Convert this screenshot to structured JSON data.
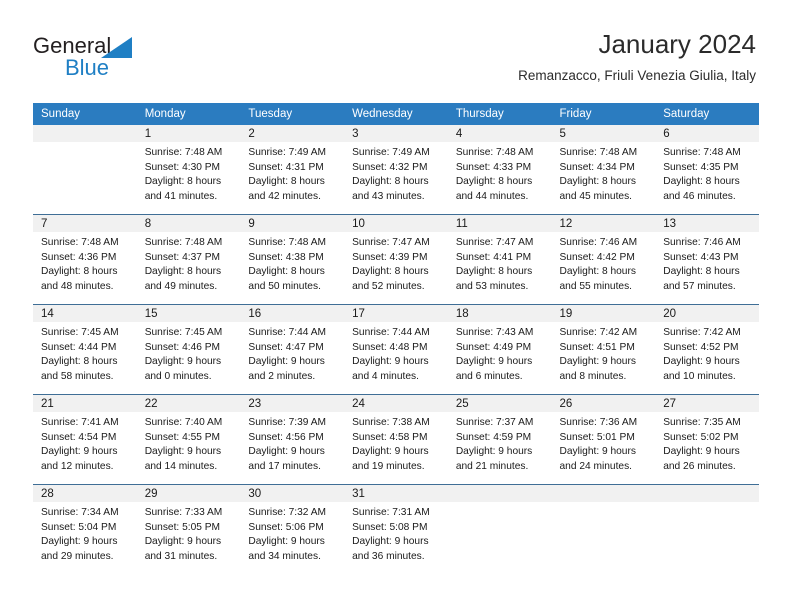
{
  "brand": {
    "word_one": "General",
    "word_two": "Blue",
    "triangle_color": "#1f7fc4",
    "word_one_color": "#231f20",
    "word_two_color": "#1f7fc4"
  },
  "header": {
    "title": "January 2024",
    "subtitle": "Remanzacco, Friuli Venezia Giulia, Italy"
  },
  "theme": {
    "header_bg": "#2b7cc0",
    "header_text": "#ffffff",
    "daynum_bg": "#f1f1f1",
    "row_rule": "#3f6e96",
    "body_text": "#1a1a1a"
  },
  "calendar": {
    "weekday_headers": [
      "Sunday",
      "Monday",
      "Tuesday",
      "Wednesday",
      "Thursday",
      "Friday",
      "Saturday"
    ],
    "weeks": [
      [
        {
          "day": "",
          "lines": []
        },
        {
          "day": "1",
          "lines": [
            "Sunrise: 7:48 AM",
            "Sunset: 4:30 PM",
            "Daylight: 8 hours",
            "and 41 minutes."
          ]
        },
        {
          "day": "2",
          "lines": [
            "Sunrise: 7:49 AM",
            "Sunset: 4:31 PM",
            "Daylight: 8 hours",
            "and 42 minutes."
          ]
        },
        {
          "day": "3",
          "lines": [
            "Sunrise: 7:49 AM",
            "Sunset: 4:32 PM",
            "Daylight: 8 hours",
            "and 43 minutes."
          ]
        },
        {
          "day": "4",
          "lines": [
            "Sunrise: 7:48 AM",
            "Sunset: 4:33 PM",
            "Daylight: 8 hours",
            "and 44 minutes."
          ]
        },
        {
          "day": "5",
          "lines": [
            "Sunrise: 7:48 AM",
            "Sunset: 4:34 PM",
            "Daylight: 8 hours",
            "and 45 minutes."
          ]
        },
        {
          "day": "6",
          "lines": [
            "Sunrise: 7:48 AM",
            "Sunset: 4:35 PM",
            "Daylight: 8 hours",
            "and 46 minutes."
          ]
        }
      ],
      [
        {
          "day": "7",
          "lines": [
            "Sunrise: 7:48 AM",
            "Sunset: 4:36 PM",
            "Daylight: 8 hours",
            "and 48 minutes."
          ]
        },
        {
          "day": "8",
          "lines": [
            "Sunrise: 7:48 AM",
            "Sunset: 4:37 PM",
            "Daylight: 8 hours",
            "and 49 minutes."
          ]
        },
        {
          "day": "9",
          "lines": [
            "Sunrise: 7:48 AM",
            "Sunset: 4:38 PM",
            "Daylight: 8 hours",
            "and 50 minutes."
          ]
        },
        {
          "day": "10",
          "lines": [
            "Sunrise: 7:47 AM",
            "Sunset: 4:39 PM",
            "Daylight: 8 hours",
            "and 52 minutes."
          ]
        },
        {
          "day": "11",
          "lines": [
            "Sunrise: 7:47 AM",
            "Sunset: 4:41 PM",
            "Daylight: 8 hours",
            "and 53 minutes."
          ]
        },
        {
          "day": "12",
          "lines": [
            "Sunrise: 7:46 AM",
            "Sunset: 4:42 PM",
            "Daylight: 8 hours",
            "and 55 minutes."
          ]
        },
        {
          "day": "13",
          "lines": [
            "Sunrise: 7:46 AM",
            "Sunset: 4:43 PM",
            "Daylight: 8 hours",
            "and 57 minutes."
          ]
        }
      ],
      [
        {
          "day": "14",
          "lines": [
            "Sunrise: 7:45 AM",
            "Sunset: 4:44 PM",
            "Daylight: 8 hours",
            "and 58 minutes."
          ]
        },
        {
          "day": "15",
          "lines": [
            "Sunrise: 7:45 AM",
            "Sunset: 4:46 PM",
            "Daylight: 9 hours",
            "and 0 minutes."
          ]
        },
        {
          "day": "16",
          "lines": [
            "Sunrise: 7:44 AM",
            "Sunset: 4:47 PM",
            "Daylight: 9 hours",
            "and 2 minutes."
          ]
        },
        {
          "day": "17",
          "lines": [
            "Sunrise: 7:44 AM",
            "Sunset: 4:48 PM",
            "Daylight: 9 hours",
            "and 4 minutes."
          ]
        },
        {
          "day": "18",
          "lines": [
            "Sunrise: 7:43 AM",
            "Sunset: 4:49 PM",
            "Daylight: 9 hours",
            "and 6 minutes."
          ]
        },
        {
          "day": "19",
          "lines": [
            "Sunrise: 7:42 AM",
            "Sunset: 4:51 PM",
            "Daylight: 9 hours",
            "and 8 minutes."
          ]
        },
        {
          "day": "20",
          "lines": [
            "Sunrise: 7:42 AM",
            "Sunset: 4:52 PM",
            "Daylight: 9 hours",
            "and 10 minutes."
          ]
        }
      ],
      [
        {
          "day": "21",
          "lines": [
            "Sunrise: 7:41 AM",
            "Sunset: 4:54 PM",
            "Daylight: 9 hours",
            "and 12 minutes."
          ]
        },
        {
          "day": "22",
          "lines": [
            "Sunrise: 7:40 AM",
            "Sunset: 4:55 PM",
            "Daylight: 9 hours",
            "and 14 minutes."
          ]
        },
        {
          "day": "23",
          "lines": [
            "Sunrise: 7:39 AM",
            "Sunset: 4:56 PM",
            "Daylight: 9 hours",
            "and 17 minutes."
          ]
        },
        {
          "day": "24",
          "lines": [
            "Sunrise: 7:38 AM",
            "Sunset: 4:58 PM",
            "Daylight: 9 hours",
            "and 19 minutes."
          ]
        },
        {
          "day": "25",
          "lines": [
            "Sunrise: 7:37 AM",
            "Sunset: 4:59 PM",
            "Daylight: 9 hours",
            "and 21 minutes."
          ]
        },
        {
          "day": "26",
          "lines": [
            "Sunrise: 7:36 AM",
            "Sunset: 5:01 PM",
            "Daylight: 9 hours",
            "and 24 minutes."
          ]
        },
        {
          "day": "27",
          "lines": [
            "Sunrise: 7:35 AM",
            "Sunset: 5:02 PM",
            "Daylight: 9 hours",
            "and 26 minutes."
          ]
        }
      ],
      [
        {
          "day": "28",
          "lines": [
            "Sunrise: 7:34 AM",
            "Sunset: 5:04 PM",
            "Daylight: 9 hours",
            "and 29 minutes."
          ]
        },
        {
          "day": "29",
          "lines": [
            "Sunrise: 7:33 AM",
            "Sunset: 5:05 PM",
            "Daylight: 9 hours",
            "and 31 minutes."
          ]
        },
        {
          "day": "30",
          "lines": [
            "Sunrise: 7:32 AM",
            "Sunset: 5:06 PM",
            "Daylight: 9 hours",
            "and 34 minutes."
          ]
        },
        {
          "day": "31",
          "lines": [
            "Sunrise: 7:31 AM",
            "Sunset: 5:08 PM",
            "Daylight: 9 hours",
            "and 36 minutes."
          ]
        },
        {
          "day": "",
          "lines": []
        },
        {
          "day": "",
          "lines": []
        },
        {
          "day": "",
          "lines": []
        }
      ]
    ]
  }
}
